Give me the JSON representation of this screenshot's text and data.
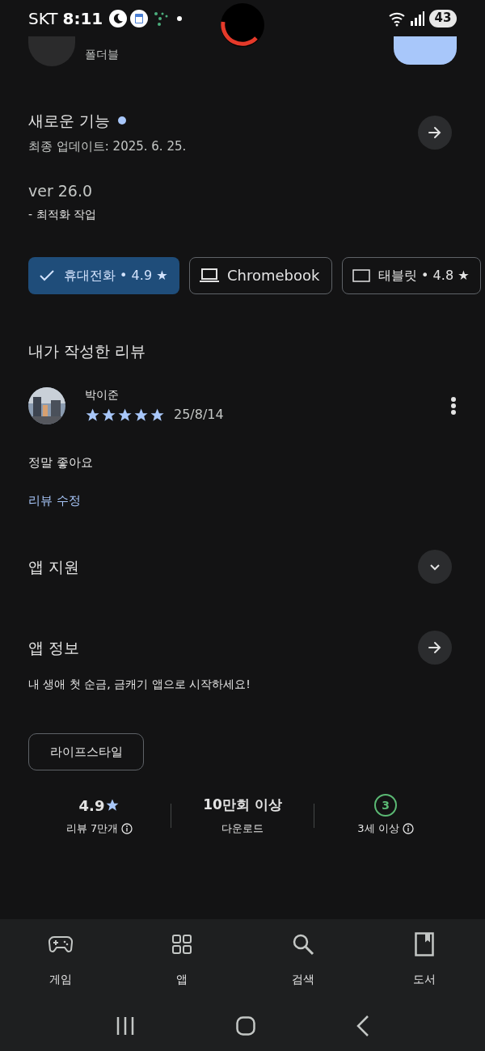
{
  "status_bar": {
    "carrier": "SKT",
    "time": "8:11",
    "battery": "43"
  },
  "app_header": {
    "subtitle": "폴더블"
  },
  "whats_new": {
    "title": "새로운 기능",
    "updated": "최종 업데이트: 2025. 6. 25.",
    "version": "ver 26.0",
    "notes": "- 최적화 작업"
  },
  "device_tabs": [
    {
      "kind": "phone",
      "label": "휴대전화 • 4.9 ★",
      "selected": true
    },
    {
      "kind": "laptop",
      "label": "Chromebook",
      "selected": false
    },
    {
      "kind": "tablet",
      "label": "태블릿 • 4.8 ★",
      "selected": false
    }
  ],
  "my_review": {
    "heading": "내가 작성한 리뷰",
    "author": "박이준",
    "stars": 5,
    "date": "25/8/14",
    "text": "정말 좋아요",
    "edit_link": "리뷰 수정"
  },
  "app_support": {
    "title": "앱 지원"
  },
  "app_info": {
    "title": "앱 정보",
    "description": "내 생애 첫 순금, 금캐기 앱으로 시작하세요!",
    "category": "라이프스타일"
  },
  "stats": [
    {
      "kind": "rating",
      "value": "4.9",
      "label": "리뷰 7만개"
    },
    {
      "kind": "downloads",
      "value": "10만회 이상",
      "label": "다운로드"
    },
    {
      "kind": "age",
      "value": "3",
      "label": "3세 이상"
    }
  ],
  "bottom_nav": [
    {
      "kind": "games",
      "label": "게임"
    },
    {
      "kind": "apps",
      "label": "앱"
    },
    {
      "kind": "search",
      "label": "검색"
    },
    {
      "kind": "books",
      "label": "도서"
    }
  ]
}
